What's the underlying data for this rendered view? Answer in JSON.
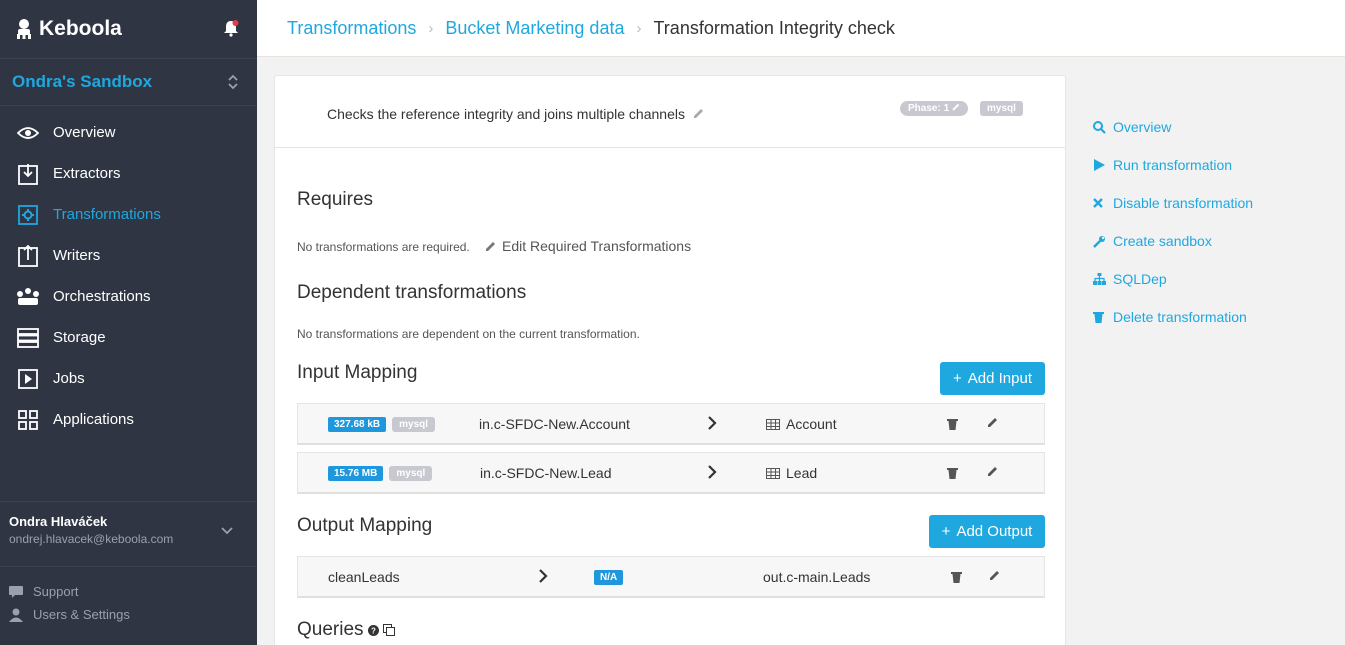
{
  "sidebar": {
    "brand": "Keboola",
    "project": "Ondra's Sandbox",
    "items": [
      {
        "label": "Overview"
      },
      {
        "label": "Extractors"
      },
      {
        "label": "Transformations"
      },
      {
        "label": "Writers"
      },
      {
        "label": "Orchestrations"
      },
      {
        "label": "Storage"
      },
      {
        "label": "Jobs"
      },
      {
        "label": "Applications"
      }
    ],
    "active_index": 2,
    "user_name": "Ondra Hlaváček",
    "user_email": "ondrej.hlavacek@keboola.com",
    "footer": [
      {
        "label": "Support"
      },
      {
        "label": "Users & Settings"
      }
    ]
  },
  "breadcrumb": {
    "items": [
      "Transformations",
      "Bucket Marketing data"
    ],
    "current": "Transformation Integrity check"
  },
  "detail": {
    "description": "Checks the reference integrity and joins multiple channels",
    "phase_badge": "Phase: 1",
    "backend_badge": "mysql",
    "requires_title": "Requires",
    "requires_text": "No transformations are required.",
    "edit_required_label": "Edit Required Transformations",
    "dependent_title": "Dependent transformations",
    "dependent_text": "No transformations are dependent on the current transformation.",
    "input_title": "Input Mapping",
    "add_input_label": "Add Input",
    "inputs": [
      {
        "size": "327.68 kB",
        "backend": "mysql",
        "source": "in.c-SFDC-New.Account",
        "dest": "Account"
      },
      {
        "size": "15.76 MB",
        "backend": "mysql",
        "source": "in.c-SFDC-New.Lead",
        "dest": "Lead"
      }
    ],
    "output_title": "Output Mapping",
    "add_output_label": "Add Output",
    "outputs": [
      {
        "source": "cleanLeads",
        "size": "N/A",
        "dest": "out.c-main.Leads"
      }
    ],
    "queries_title": "Queries"
  },
  "actions": [
    {
      "label": "Overview",
      "icon": "search-icon"
    },
    {
      "label": "Run transformation",
      "icon": "play-icon"
    },
    {
      "label": "Disable transformation",
      "icon": "close-icon"
    },
    {
      "label": "Create sandbox",
      "icon": "wrench-icon"
    },
    {
      "label": "SQLDep",
      "icon": "sitemap-icon"
    },
    {
      "label": "Delete transformation",
      "icon": "trash-icon"
    }
  ],
  "colors": {
    "accent": "#1fa8e0",
    "sidebar": "#2f3542"
  }
}
